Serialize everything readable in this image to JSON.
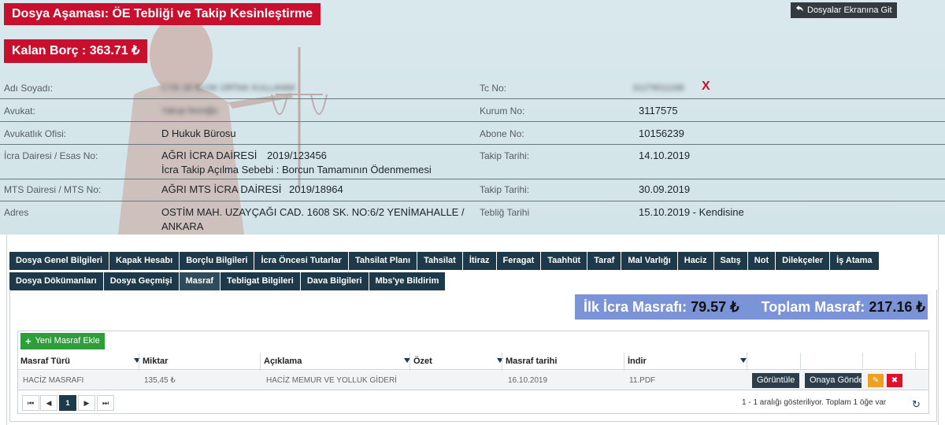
{
  "header": {
    "title": "Dosya Aşaması: ÖE Tebliği ve Takip Kesinleştirme",
    "back_label": "Dosyalar Ekranına Git",
    "remaining_debt": "Kalan Borç : 363.71 ₺"
  },
  "info": {
    "name_label": "Adı Soyadı:",
    "name_value": "CYB 1B BLOK ORTAK KULLANIM",
    "tc_label": "Tc No:",
    "tc_value": "31279511188",
    "tc_clear": "X",
    "lawyer_label": "Avukat:",
    "lawyer_value": "Yakup Nuroğlu",
    "institution_label": "Kurum No:",
    "institution_value": "3117575",
    "office_label": "Avukatlık Ofisi:",
    "office_value": "D Hukuk Bürosu",
    "subscriber_label": "Abone No:",
    "subscriber_value": "10156239",
    "icra_label": "İcra Dairesi / Esas No:",
    "icra_value": "AĞRI İCRA DAİRESİ",
    "icra_no": "2019/123456",
    "icra_reason": "İcra Takip Açılma Sebebi : Borcun Tamamının Ödenmemesi",
    "takip_label": "Takip Tarihi:",
    "takip_value": "14.10.2019",
    "mts_label": "MTS Dairesi / MTS No:",
    "mts_value": "AĞRI MTS İCRA DAİRESİ",
    "mts_no": "2019/18964",
    "takip2_label": "Takip Tarihi:",
    "takip2_value": "30.09.2019",
    "address_label": "Adres",
    "address_line1": "OSTİM MAH. UZAYÇAĞI CAD. 1608 SK. NO:6/2 YENİMAHALLE /",
    "address_line2": "ANKARA",
    "teblig_label": "Tebliğ Tarihi",
    "teblig_value": "15.10.2019 - Kendisine"
  },
  "tabs_row1": [
    "Dosya Genel Bilgileri",
    "Kapak Hesabı",
    "Borçlu Bilgileri",
    "İcra Öncesi Tutarlar",
    "Tahsilat Planı",
    "Tahsilat",
    "İtiraz",
    "Feragat",
    "Taahhüt",
    "Taraf",
    "Mal Varlığı",
    "Haciz",
    "Satış",
    "Not",
    "Dilekçeler",
    "İş Atama"
  ],
  "tabs_row2": [
    "Dosya Dökümanları",
    "Dosya Geçmişi",
    "Masraf",
    "Tebligat Bilgileri",
    "Dava Bilgileri",
    "Mbs'ye Bildirim"
  ],
  "active_tab": "Masraf",
  "totals": {
    "first_label": "İlk İcra Masrafı:",
    "first_value": "79.57 ₺",
    "total_label": "Toplam Masraf:",
    "total_value": "217.16 ₺"
  },
  "grid": {
    "add_label": "Yeni Masraf Ekle",
    "columns": [
      "Masraf Türü",
      "Miktar",
      "Açıklama",
      "Özet",
      "Masraf tarihi",
      "İndir"
    ],
    "rows": [
      {
        "type": "HACİZ MASRAFI",
        "amount": "135,45 ₺",
        "description": "HACİZ MEMUR VE YOLLUK GİDERİ",
        "summary": "",
        "date": "16.10.2019",
        "download": "11.PDF",
        "view_label": "Görüntüle",
        "approve_label": "Onaya Gönder"
      }
    ],
    "page": "1",
    "paging_info": "1 - 1 aralığı gösteriliyor. Toplam 1 öğe var"
  },
  "colors": {
    "brand_red": "#c8102e",
    "tab_bg": "#1e3a4a",
    "totals_bg": "#7b93d7",
    "add_green": "#2e9e3a",
    "edit_orange": "#f0a020",
    "delete_red": "#e0102a"
  },
  "icons": [
    "back-arrow-icon",
    "plus-icon",
    "filter-icon",
    "pencil-icon",
    "close-icon",
    "first-page-icon",
    "prev-page-icon",
    "next-page-icon",
    "last-page-icon",
    "refresh-icon"
  ]
}
